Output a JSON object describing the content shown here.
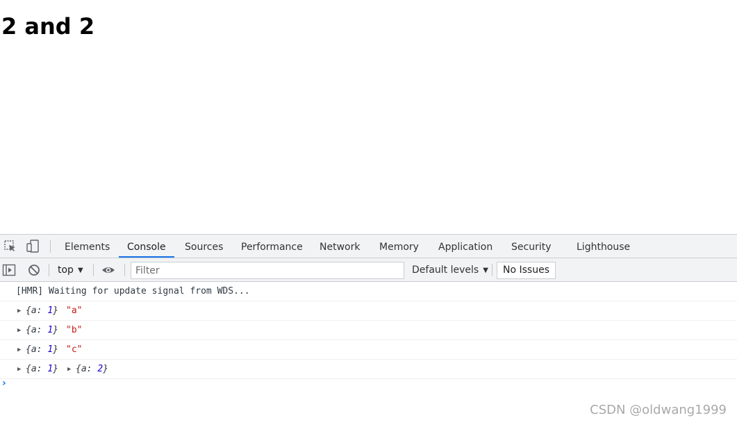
{
  "page": {
    "heading": "2 and 2"
  },
  "devtools": {
    "tabs": [
      {
        "label": "Elements"
      },
      {
        "label": "Console",
        "active": true
      },
      {
        "label": "Sources"
      },
      {
        "label": "Performance"
      },
      {
        "label": "Network"
      },
      {
        "label": "Memory"
      },
      {
        "label": "Application"
      },
      {
        "label": "Security"
      },
      {
        "label": "Lighthouse"
      }
    ],
    "toolbar": {
      "context": "top",
      "filter_placeholder": "Filter",
      "levels": "Default levels",
      "issues": "No Issues"
    },
    "console": {
      "hmr_message": "[HMR] Waiting for update signal from WDS...",
      "entries": [
        {
          "object": "{a: 1}",
          "object_key": "a",
          "object_value": "1",
          "string": "\"a\""
        },
        {
          "object": "{a: 1}",
          "object_key": "a",
          "object_value": "1",
          "string": "\"b\""
        },
        {
          "object": "{a: 1}",
          "object_key": "a",
          "object_value": "1",
          "string": "\"c\""
        },
        {
          "object": "{a: 1}",
          "object_key": "a",
          "object_value": "1",
          "second_object": "{a: 2}",
          "second_key": "a",
          "second_value": "2"
        }
      ]
    }
  },
  "watermark": "CSDN @oldwang1999",
  "colors": {
    "accent": "#1a73e8",
    "string": "#c41a16",
    "number": "#1c00cf",
    "toolbar_bg": "#f1f3f4"
  },
  "icons": [
    "inspect-element-icon",
    "device-toolbar-icon",
    "sidebar-toggle-icon",
    "clear-console-icon",
    "live-expression-eye-icon",
    "dropdown-caret-icon",
    "expand-triangle-icon",
    "console-prompt-chevron-icon"
  ]
}
